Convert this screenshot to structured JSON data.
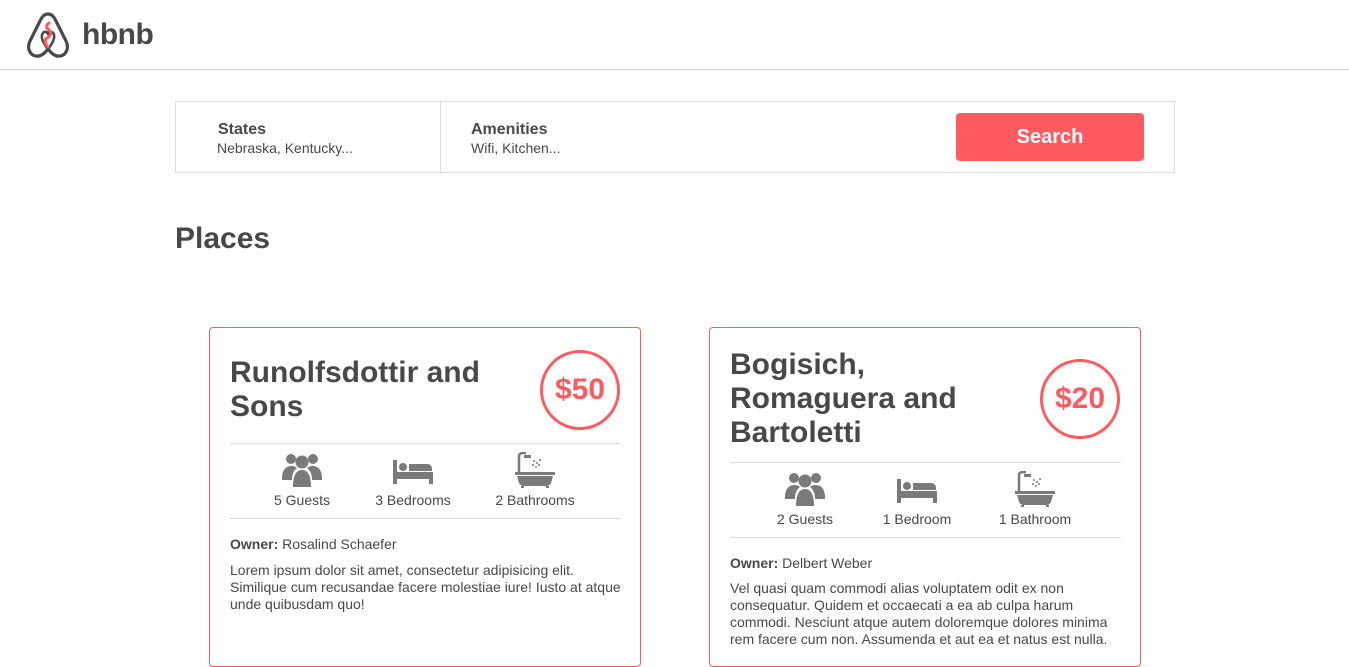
{
  "header": {
    "brand": "hbnb"
  },
  "filters": {
    "states_title": "States",
    "states_value": "Nebraska, Kentucky...",
    "amenities_title": "Amenities",
    "amenities_value": "Wifi, Kitchen...",
    "search_label": "Search"
  },
  "places": {
    "title": "Places",
    "items": [
      {
        "name": "Runolfsdottir and Sons",
        "price": "$50",
        "guests": "5 Guests",
        "bedrooms": "3 Bedrooms",
        "bathrooms": "2 Bathrooms",
        "owner_label": "Owner:",
        "owner": "Rosalind Schaefer",
        "description": "Lorem ipsum dolor sit amet, consectetur adipisicing elit. Similique cum recusandae facere molestiae iure! Iusto at atque unde quibusdam quo!"
      },
      {
        "name": "Bogisich, Romaguera and Bartoletti",
        "price": "$20",
        "guests": "2 Guests",
        "bedrooms": "1 Bedroom",
        "bathrooms": "1 Bathroom",
        "owner_label": "Owner:",
        "owner": "Delbert Weber",
        "description": "Vel quasi quam commodi alias voluptatem odit ex non consequatur. Quidem et occaecati a ea ab culpa harum commodi. Nesciunt atque autem doloremque dolores minima rem facere cum non. Assumenda et aut ea et natus est nulla."
      }
    ]
  },
  "colors": {
    "accent": "#ff5a5f",
    "text": "#484848",
    "border": "#dddddd"
  },
  "icons": [
    "hbnb-logo-icon",
    "guests-icon",
    "bed-icon",
    "bathtub-icon"
  ]
}
